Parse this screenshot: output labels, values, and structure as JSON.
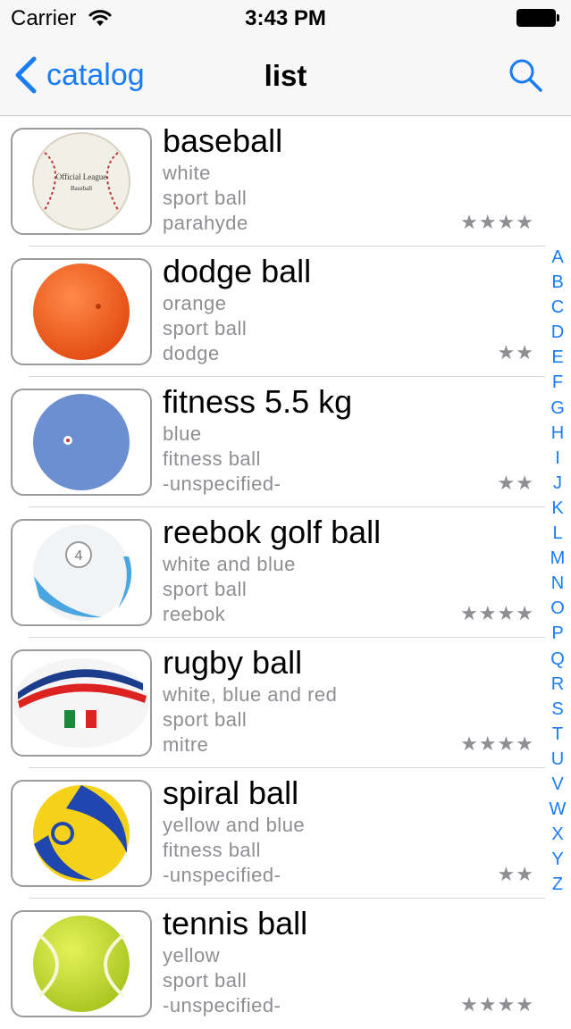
{
  "status_bar": {
    "carrier": "Carrier",
    "time": "3:43 PM"
  },
  "nav": {
    "back_label": "catalog",
    "title": "list"
  },
  "colors": {
    "accent": "#1a7cf4",
    "secondary_text": "#8e8e93"
  },
  "items": [
    {
      "name": "baseball",
      "color": "white",
      "category": "sport ball",
      "brand": "parahyde",
      "stars": "★★★★"
    },
    {
      "name": "dodge ball",
      "color": "orange",
      "category": "sport ball",
      "brand": "dodge",
      "stars": "★★"
    },
    {
      "name": "fitness 5.5 kg",
      "color": "blue",
      "category": "fitness ball",
      "brand": "-unspecified-",
      "stars": "★★"
    },
    {
      "name": "reebok golf ball",
      "color": "white and blue",
      "category": "sport ball",
      "brand": "reebok",
      "stars": "★★★★"
    },
    {
      "name": "rugby ball",
      "color": "white, blue and red",
      "category": "sport ball",
      "brand": "mitre",
      "stars": "★★★★"
    },
    {
      "name": "spiral ball",
      "color": "yellow and blue",
      "category": "fitness ball",
      "brand": "-unspecified-",
      "stars": "★★"
    },
    {
      "name": "tennis ball",
      "color": "yellow",
      "category": "sport ball",
      "brand": "-unspecified-",
      "stars": "★★★★"
    }
  ],
  "index_letters": [
    "A",
    "B",
    "C",
    "D",
    "E",
    "F",
    "G",
    "H",
    "I",
    "J",
    "K",
    "L",
    "M",
    "N",
    "O",
    "P",
    "Q",
    "R",
    "S",
    "T",
    "U",
    "V",
    "W",
    "X",
    "Y",
    "Z"
  ]
}
